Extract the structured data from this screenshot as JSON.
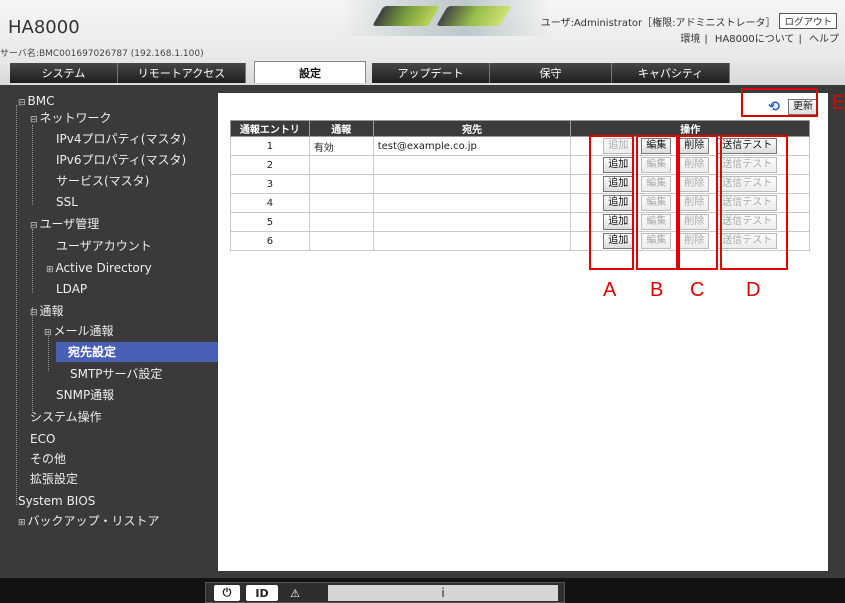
{
  "header": {
    "logo": "HA8000",
    "server_name": "サーバ名:BMC001697026787 (192.168.1.100)",
    "user_text": "ユーザ:Administrator［権限:アドミニストレータ］",
    "logout_label": "ログアウト",
    "links": [
      "環境",
      "HA8000について",
      "ヘルプ"
    ]
  },
  "tabs": [
    {
      "label": "システム"
    },
    {
      "label": "リモートアクセス"
    },
    {
      "label": "設定"
    },
    {
      "label": "アップデート"
    },
    {
      "label": "保守"
    },
    {
      "label": "キャパシティ"
    }
  ],
  "sidebar": {
    "items": [
      {
        "label": "BMC",
        "toggle": "⊟"
      },
      {
        "label": "ネットワーク",
        "toggle": "⊟"
      },
      {
        "label": "IPv4プロパティ(マスタ)"
      },
      {
        "label": "IPv6プロパティ(マスタ)"
      },
      {
        "label": "サービス(マスタ)"
      },
      {
        "label": "SSL"
      },
      {
        "label": "ユーザ管理",
        "toggle": "⊟"
      },
      {
        "label": "ユーザアカウント"
      },
      {
        "label": "Active Directory",
        "toggle": "⊞"
      },
      {
        "label": "LDAP"
      },
      {
        "label": "通報",
        "toggle": "⊟"
      },
      {
        "label": "メール通報",
        "toggle": "⊟"
      },
      {
        "label": "宛先設定"
      },
      {
        "label": "SMTPサーバ設定"
      },
      {
        "label": "SNMP通報"
      },
      {
        "label": "システム操作"
      },
      {
        "label": "ECO"
      },
      {
        "label": "その他"
      },
      {
        "label": "拡張設定"
      },
      {
        "label": "System BIOS"
      },
      {
        "label": "バックアップ・リストア",
        "toggle": "⊞"
      }
    ]
  },
  "toolbar": {
    "refresh_label": "更新"
  },
  "table": {
    "headers": [
      "通報エントリ",
      "通報",
      "宛先",
      "操作"
    ],
    "rows": [
      {
        "entry": "1",
        "notify": "有効",
        "dest": "test@example.co.jp"
      },
      {
        "entry": "2",
        "notify": "",
        "dest": ""
      },
      {
        "entry": "3",
        "notify": "",
        "dest": ""
      },
      {
        "entry": "4",
        "notify": "",
        "dest": ""
      },
      {
        "entry": "5",
        "notify": "",
        "dest": ""
      },
      {
        "entry": "6",
        "notify": "",
        "dest": ""
      }
    ],
    "ops": {
      "add": "追加",
      "edit": "編集",
      "delete": "削除",
      "test": "送信テスト"
    }
  },
  "annotations": {
    "a": "A",
    "b": "B",
    "c": "C",
    "d": "D",
    "e": "E"
  },
  "footer": {
    "power": "⏻",
    "id": "ID",
    "alert": "⚠",
    "status": "i"
  },
  "colors": {
    "accent_red": "#e00000",
    "selected_item": "#485fb6",
    "refresh_icon": "#2a62c8"
  }
}
